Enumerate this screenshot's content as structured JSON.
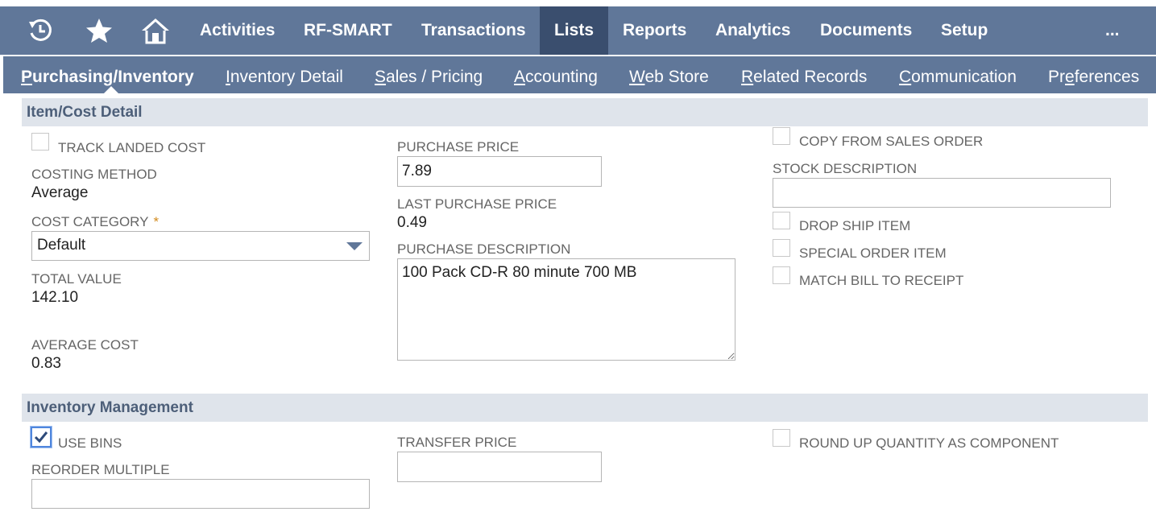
{
  "topnav": {
    "icons": [
      "recent-icon",
      "star-icon",
      "home-icon"
    ],
    "items": [
      "Activities",
      "RF-SMART",
      "Transactions",
      "Lists",
      "Reports",
      "Analytics",
      "Documents",
      "Setup"
    ],
    "more": "..."
  },
  "subtabs": {
    "purchasing": {
      "u": "P",
      "rest": "urchasing/Inventory"
    },
    "inventory_detail": {
      "u": "I",
      "rest": "nventory Detail"
    },
    "sales_pricing": {
      "u": "S",
      "rest": "ales / Pricing"
    },
    "accounting": {
      "u": "A",
      "rest": "ccounting"
    },
    "web_store": {
      "u": "W",
      "rest": "eb Store"
    },
    "related_records": {
      "u": "R",
      "rest": "elated Records"
    },
    "communication": {
      "u": "C",
      "rest": "ommunication"
    },
    "preferences": {
      "pre": "Pr",
      "u": "e",
      "rest": "ferences"
    }
  },
  "cost_detail": {
    "title": "Item/Cost Detail",
    "track_landed_cost": "TRACK LANDED COST",
    "costing_method_label": "COSTING METHOD",
    "costing_method_value": "Average",
    "cost_category_label": "COST CATEGORY",
    "cost_category_required": "*",
    "cost_category_value": "Default",
    "total_value_label": "TOTAL VALUE",
    "total_value": "142.10",
    "average_cost_label": "AVERAGE COST",
    "average_cost": "0.83",
    "purchase_price_label": "PURCHASE PRICE",
    "purchase_price": "7.89",
    "last_purchase_price_label": "LAST PURCHASE PRICE",
    "last_purchase_price": "0.49",
    "purchase_description_label": "PURCHASE DESCRIPTION",
    "purchase_description": "100 Pack CD-R 80 minute 700 MB",
    "copy_from_sales_order": "COPY FROM SALES ORDER",
    "stock_description_label": "STOCK DESCRIPTION",
    "stock_description": "",
    "drop_ship_item": "DROP SHIP ITEM",
    "special_order_item": "SPECIAL ORDER ITEM",
    "match_bill_to_receipt": "MATCH BILL TO RECEIPT"
  },
  "inventory_mgmt": {
    "title": "Inventory Management",
    "use_bins": "USE BINS",
    "reorder_multiple_label": "REORDER MULTIPLE",
    "reorder_multiple": "",
    "transfer_price_label": "TRANSFER PRICE",
    "transfer_price": "",
    "round_up_quantity": "ROUND UP QUANTITY AS COMPONENT"
  },
  "colors": {
    "nav_bg": "#607799",
    "nav_active": "#3a4e6e",
    "section_bg": "#dfe4eb",
    "section_text": "#4d5f79",
    "required": "#d28b1f",
    "checkbox_focus": "#4f86dd"
  }
}
